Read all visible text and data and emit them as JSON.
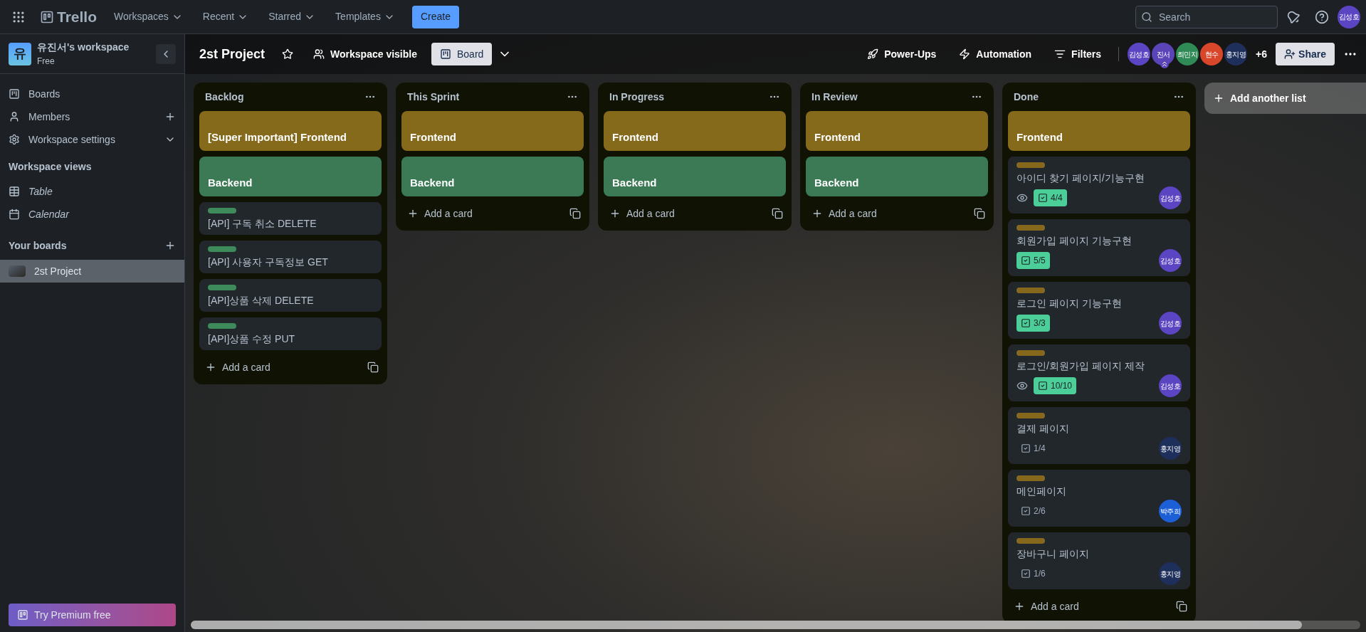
{
  "top_nav": {
    "logo": "Trello",
    "menus": [
      {
        "label": "Workspaces"
      },
      {
        "label": "Recent"
      },
      {
        "label": "Starred"
      },
      {
        "label": "Templates"
      }
    ],
    "create": "Create",
    "search": {
      "placeholder": "Search"
    },
    "user": {
      "initials": "김성호",
      "color": "#5b45c2"
    }
  },
  "sidebar": {
    "workspace": {
      "initial": "유",
      "name": "유진서's workspace",
      "plan": "Free"
    },
    "items": [
      {
        "label": "Boards",
        "kind": "boards"
      },
      {
        "label": "Members",
        "kind": "members"
      },
      {
        "label": "Workspace settings",
        "kind": "settings"
      }
    ],
    "views_title": "Workspace views",
    "views": [
      {
        "label": "Table",
        "kind": "table"
      },
      {
        "label": "Calendar",
        "kind": "calendar"
      }
    ],
    "boards_title": "Your boards",
    "boards": [
      {
        "name": "2st Project",
        "selected": true
      }
    ],
    "premium": "Try Premium free"
  },
  "board_header": {
    "title": "2st Project",
    "starred": false,
    "visibility": "Workspace visible",
    "views": [
      {
        "label": "Board",
        "selected": true
      }
    ],
    "actions": [
      {
        "label": "Power-Ups",
        "kind": "powerups"
      },
      {
        "label": "Automation",
        "kind": "automation"
      },
      {
        "label": "Filters",
        "kind": "filters"
      }
    ],
    "members": [
      {
        "initials": "김성호",
        "color": "#5b45c2",
        "admin": false
      },
      {
        "initials": "진서",
        "color": "#5a44b8",
        "admin": true
      },
      {
        "initials": "최민지",
        "color": "#2f8a55",
        "admin": false
      },
      {
        "initials": "현수",
        "color": "#d9472b",
        "admin": false
      },
      {
        "initials": "홍지영",
        "color": "#1e2f5c",
        "admin": false
      }
    ],
    "more_members": "+6",
    "share": "Share"
  },
  "lists": [
    {
      "title": "Backlog",
      "add_card": "Add a card",
      "cards": [
        {
          "kind": "cover",
          "title": "[Super Important] Frontend",
          "color": "#866a1c"
        },
        {
          "kind": "cover",
          "title": "Backend",
          "color": "#3b7a55"
        },
        {
          "kind": "normal",
          "title": "[API] 구독 취소 DELETE",
          "labels": [
            {
              "color": "#3d8a5a"
            }
          ]
        },
        {
          "kind": "normal",
          "title": "[API] 사용자 구독정보 GET",
          "labels": [
            {
              "color": "#3d8a5a"
            }
          ]
        },
        {
          "kind": "normal",
          "title": "[API]상품 삭제 DELETE",
          "labels": [
            {
              "color": "#3d8a5a"
            }
          ]
        },
        {
          "kind": "normal",
          "title": "[API]상품 수정 PUT",
          "labels": [
            {
              "color": "#3d8a5a"
            }
          ]
        }
      ]
    },
    {
      "title": "This Sprint",
      "add_card": "Add a card",
      "cards": [
        {
          "kind": "cover",
          "title": "Frontend",
          "color": "#866a1c"
        },
        {
          "kind": "cover",
          "title": "Backend",
          "color": "#3b7a55"
        }
      ]
    },
    {
      "title": "In Progress",
      "add_card": "Add a card",
      "cards": [
        {
          "kind": "cover",
          "title": "Frontend",
          "color": "#866a1c"
        },
        {
          "kind": "cover",
          "title": "Backend",
          "color": "#3b7a55"
        }
      ]
    },
    {
      "title": "In Review",
      "add_card": "Add a card",
      "cards": [
        {
          "kind": "cover",
          "title": "Frontend",
          "color": "#866a1c"
        },
        {
          "kind": "cover",
          "title": "Backend",
          "color": "#3b7a55"
        }
      ]
    },
    {
      "title": "Done",
      "add_card": "Add a card",
      "cards": [
        {
          "kind": "cover",
          "title": "Frontend",
          "color": "#866a1c"
        },
        {
          "kind": "normal",
          "title": "아이디 찾기 페이지/기능구현",
          "labels": [
            {
              "color": "#86691c"
            }
          ],
          "watching": true,
          "checklist": {
            "text": "4/4",
            "complete": true
          },
          "member": {
            "initials": "김성호",
            "color": "#5b45c2"
          }
        },
        {
          "kind": "normal",
          "title": "회원가입 페이지 기능구현",
          "labels": [
            {
              "color": "#86691c"
            }
          ],
          "watching": false,
          "checklist": {
            "text": "5/5",
            "complete": true
          },
          "member": {
            "initials": "김성호",
            "color": "#5b45c2"
          }
        },
        {
          "kind": "normal",
          "title": "로그인 페이지 기능구현",
          "labels": [
            {
              "color": "#86691c"
            }
          ],
          "watching": false,
          "checklist": {
            "text": "3/3",
            "complete": true
          },
          "member": {
            "initials": "김성호",
            "color": "#5b45c2"
          }
        },
        {
          "kind": "normal",
          "title": "로그인/회원가입 페이지 제작",
          "labels": [
            {
              "color": "#86691c"
            }
          ],
          "watching": true,
          "checklist": {
            "text": "10/10",
            "complete": true
          },
          "member": {
            "initials": "김성호",
            "color": "#5b45c2"
          }
        },
        {
          "kind": "normal",
          "title": "결제 페이지",
          "labels": [
            {
              "color": "#86691c"
            }
          ],
          "watching": false,
          "checklist": {
            "text": "1/4",
            "complete": false
          },
          "member": {
            "initials": "홍지영",
            "color": "#1e2f5c"
          }
        },
        {
          "kind": "normal",
          "title": "메인페이지",
          "labels": [
            {
              "color": "#86691c"
            }
          ],
          "watching": false,
          "checklist": {
            "text": "2/6",
            "complete": false
          },
          "member": {
            "initials": "박주희",
            "color": "#1d5fd6"
          }
        },
        {
          "kind": "normal",
          "title": "장바구니 페이지",
          "labels": [
            {
              "color": "#86691c"
            }
          ],
          "watching": false,
          "checklist": {
            "text": "1/6",
            "complete": false
          },
          "member": {
            "initials": "홍지영",
            "color": "#1e2f5c"
          }
        }
      ]
    }
  ],
  "add_list": "Add another list"
}
